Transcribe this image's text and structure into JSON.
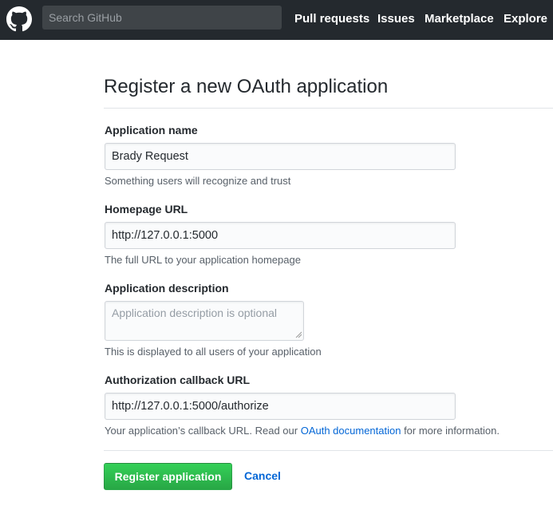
{
  "header": {
    "search_placeholder": "Search GitHub",
    "nav": [
      "Pull requests",
      "Issues",
      "Marketplace",
      "Explore"
    ]
  },
  "page_title": "Register a new OAuth application",
  "form": {
    "app_name": {
      "label": "Application name",
      "value": "Brady Request",
      "note": "Something users will recognize and trust"
    },
    "homepage_url": {
      "label": "Homepage URL",
      "value": "http://127.0.0.1:5000",
      "note": "The full URL to your application homepage"
    },
    "description": {
      "label": "Application description",
      "placeholder": "Application description is optional",
      "note": "This is displayed to all users of your application"
    },
    "callback_url": {
      "label": "Authorization callback URL",
      "value": "http://127.0.0.1:5000/authorize",
      "note_prefix": "Your application’s callback URL. Read our ",
      "note_link": "OAuth documentation",
      "note_suffix": " for more information."
    }
  },
  "actions": {
    "register_label": "Register application",
    "cancel_label": "Cancel"
  },
  "colors": {
    "header_bg": "#24292e",
    "primary_button": "#28a745",
    "link": "#0366d6"
  },
  "icons": {
    "logo": "github-octocat-icon"
  }
}
